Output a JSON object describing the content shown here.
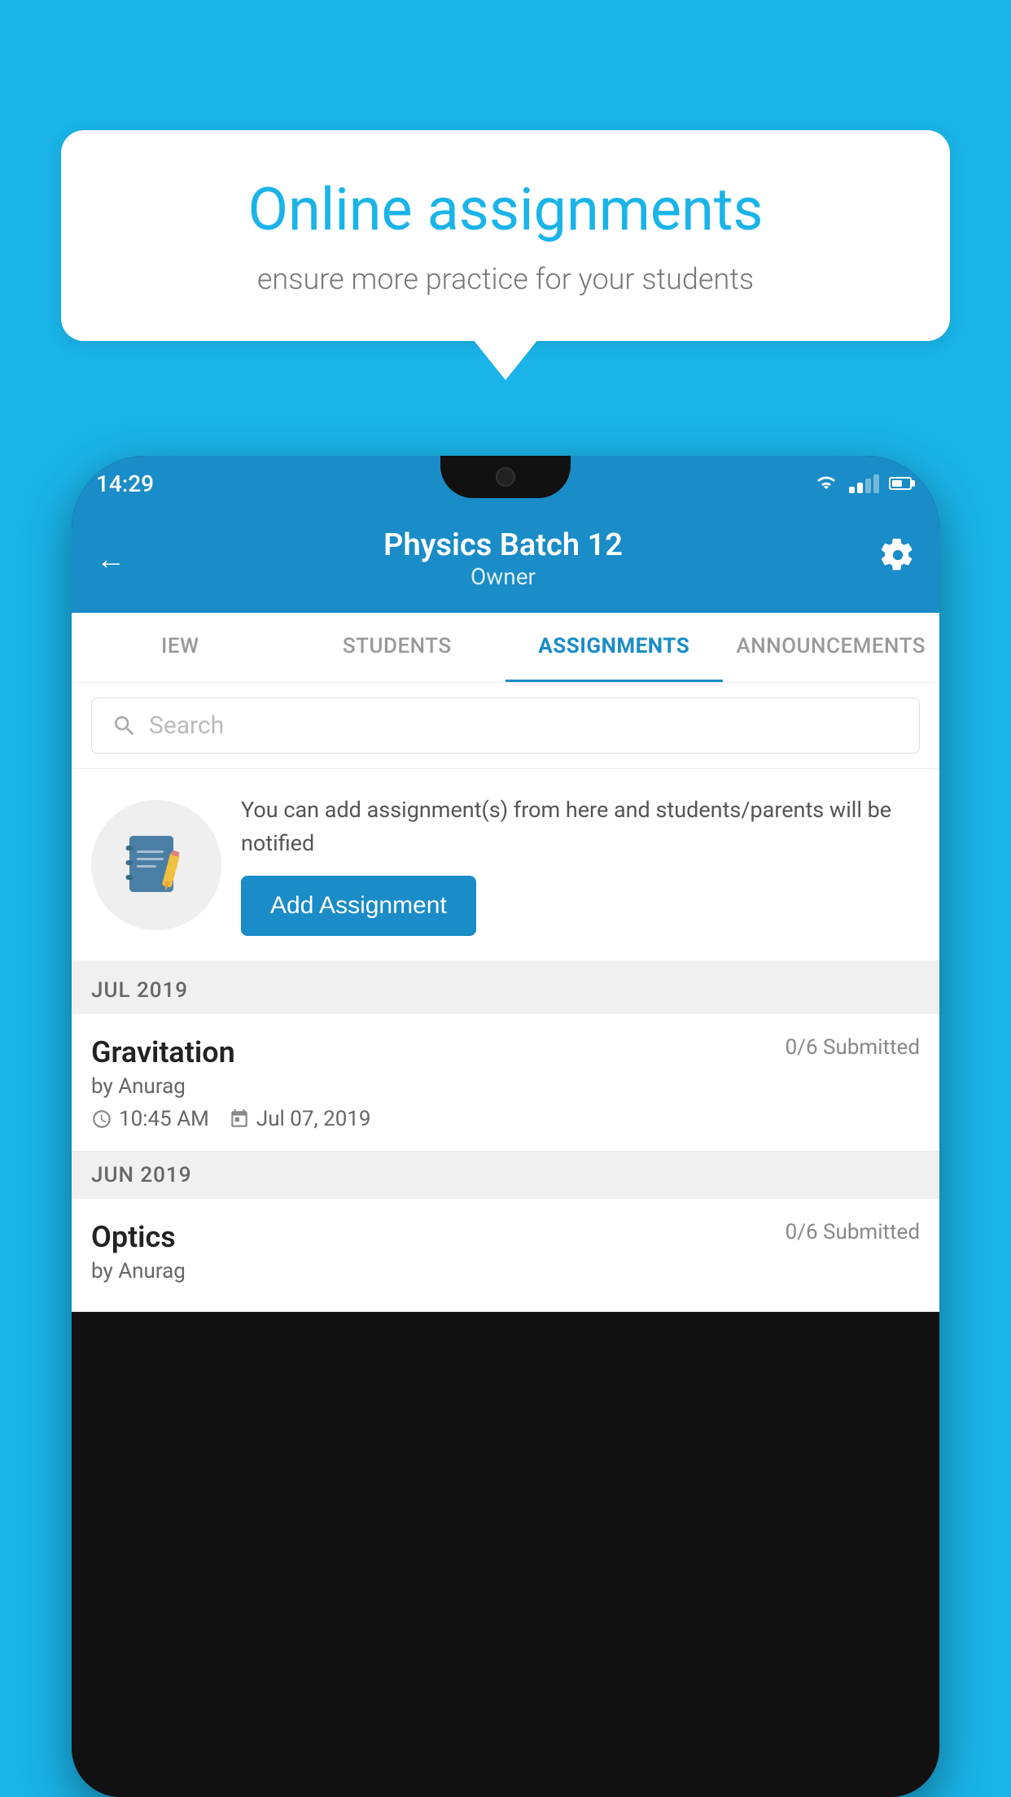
{
  "background_color": "#1ab4e8",
  "speech_bubble": {
    "title": "Online assignments",
    "subtitle": "ensure more practice for your students"
  },
  "phone": {
    "status_bar": {
      "time": "14:29"
    },
    "header": {
      "title": "Physics Batch 12",
      "subtitle": "Owner",
      "back_label": "←",
      "settings_label": "⚙"
    },
    "tabs": [
      {
        "id": "iew",
        "label": "IEW",
        "active": false
      },
      {
        "id": "students",
        "label": "STUDENTS",
        "active": false
      },
      {
        "id": "assignments",
        "label": "ASSIGNMENTS",
        "active": true
      },
      {
        "id": "announcements",
        "label": "ANNOUNCEMENTS",
        "active": false
      }
    ],
    "search": {
      "placeholder": "Search"
    },
    "promo": {
      "description": "You can add assignment(s) from here and students/parents will be notified",
      "button_label": "Add Assignment"
    },
    "sections": [
      {
        "month": "JUL 2019",
        "assignments": [
          {
            "name": "Gravitation",
            "submitted": "0/6 Submitted",
            "by": "by Anurag",
            "time": "10:45 AM",
            "date": "Jul 07, 2019"
          }
        ]
      },
      {
        "month": "JUN 2019",
        "assignments": [
          {
            "name": "Optics",
            "submitted": "0/6 Submitted",
            "by": "by Anurag",
            "time": "",
            "date": ""
          }
        ]
      }
    ]
  }
}
